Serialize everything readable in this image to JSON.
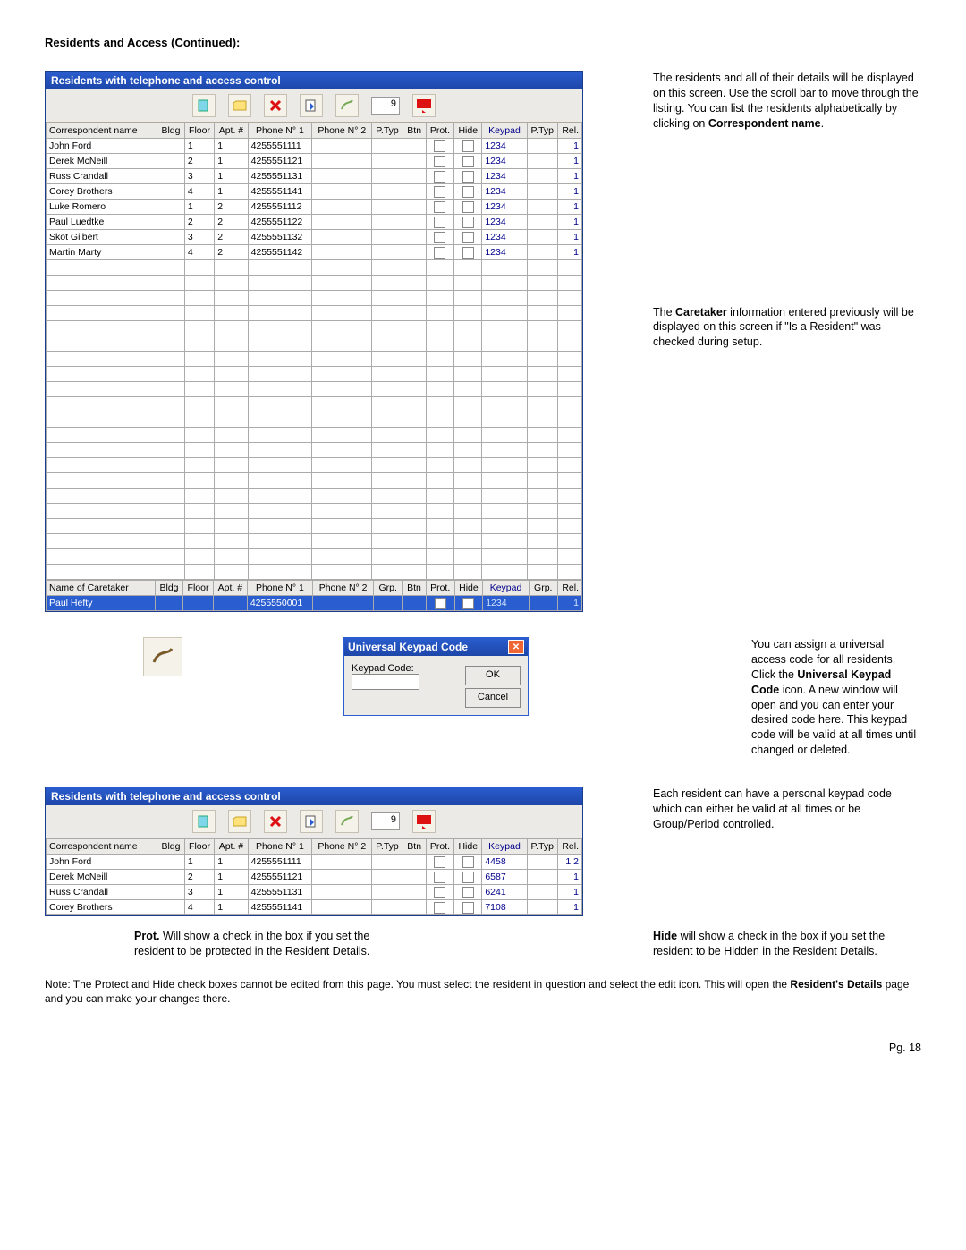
{
  "page_title": "Residents and Access (Continued):",
  "window_title": "Residents with telephone and access control",
  "toolbar_count": "9",
  "columns": [
    "Correspondent name",
    "Bldg",
    "Floor",
    "Apt. #",
    "Phone N° 1",
    "Phone N° 2",
    "P.Typ",
    "Btn",
    "Prot.",
    "Hide",
    "Keypad",
    "P.Typ",
    "Rel."
  ],
  "caretaker_columns": [
    "Name of Caretaker",
    "Bldg",
    "Floor",
    "Apt. #",
    "Phone N° 1",
    "Phone N° 2",
    "Grp.",
    "Btn",
    "Prot.",
    "Hide",
    "Keypad",
    "Grp.",
    "Rel."
  ],
  "residents1": [
    {
      "name": "John Ford",
      "bldg": "",
      "floor": "1",
      "apt": "1",
      "phone1": "4255551111",
      "keypad": "1234",
      "rel": "1"
    },
    {
      "name": "Derek McNeill",
      "bldg": "",
      "floor": "2",
      "apt": "1",
      "phone1": "4255551121",
      "keypad": "1234",
      "rel": "1"
    },
    {
      "name": "Russ Crandall",
      "bldg": "",
      "floor": "3",
      "apt": "1",
      "phone1": "4255551131",
      "keypad": "1234",
      "rel": "1"
    },
    {
      "name": "Corey Brothers",
      "bldg": "",
      "floor": "4",
      "apt": "1",
      "phone1": "4255551141",
      "keypad": "1234",
      "rel": "1"
    },
    {
      "name": "Luke Romero",
      "bldg": "",
      "floor": "1",
      "apt": "2",
      "phone1": "4255551112",
      "keypad": "1234",
      "rel": "1"
    },
    {
      "name": "Paul Luedtke",
      "bldg": "",
      "floor": "2",
      "apt": "2",
      "phone1": "4255551122",
      "keypad": "1234",
      "rel": "1"
    },
    {
      "name": "Skot Gilbert",
      "bldg": "",
      "floor": "3",
      "apt": "2",
      "phone1": "4255551132",
      "keypad": "1234",
      "rel": "1"
    },
    {
      "name": "Martin Marty",
      "bldg": "",
      "floor": "4",
      "apt": "2",
      "phone1": "4255551142",
      "keypad": "1234",
      "rel": "1"
    }
  ],
  "empty_rows_1": 21,
  "caretaker": {
    "name": "Paul Hefty",
    "phone1": "4255550001",
    "prot": false,
    "hide": true,
    "keypad": "1234",
    "rel": "1"
  },
  "dialog": {
    "title": "Universal Keypad Code",
    "label": "Keypad Code:",
    "ok": "OK",
    "cancel": "Cancel"
  },
  "residents2": [
    {
      "name": "John Ford",
      "bldg": "",
      "floor": "1",
      "apt": "1",
      "phone1": "4255551111",
      "keypad": "4458",
      "rel": "1 2"
    },
    {
      "name": "Derek McNeill",
      "bldg": "",
      "floor": "2",
      "apt": "1",
      "phone1": "4255551121",
      "keypad": "6587",
      "rel": "1"
    },
    {
      "name": "Russ Crandall",
      "bldg": "",
      "floor": "3",
      "apt": "1",
      "phone1": "4255551131",
      "keypad": "6241",
      "rel": "1"
    },
    {
      "name": "Corey Brothers",
      "bldg": "",
      "floor": "4",
      "apt": "1",
      "phone1": "4255551141",
      "keypad": "7108",
      "rel": "1"
    }
  ],
  "annot": {
    "a1_pre": "The residents and all of their details will be displayed on this screen.  Use the scroll bar to move through the listing.  You can list the residents alphabetically by clicking on ",
    "a1_bold": "Correspondent name",
    "a1_post": ".",
    "a2_pre": "The ",
    "a2_bold": "Caretaker",
    "a2_post": " information entered previously will be displayed on this screen if \"Is a Resident\" was checked during setup.",
    "a3_pre": "You can assign a universal access code for all residents. Click the ",
    "a3_bold": "Universal Keypad Code",
    "a3_post": " icon.  A new window will open and you can enter your desired code here.  This keypad code will be valid at all times until changed or deleted.",
    "a4": "Each resident can have a personal keypad code which can either be valid at all times or be Group/Period controlled.",
    "prot_bold": "Prot.",
    "prot_text": " Will show a check in the box if you set the resident to be protected in the Resident Details.",
    "hide_bold": "Hide",
    "hide_text": " will show a check in the box if you set the resident to be Hidden in the Resident Details."
  },
  "note_pre": "Note:  The Protect and Hide check boxes cannot be edited from this page.  You must select the resident in question and select the edit icon.  This will open the ",
  "note_bold": "Resident's Details",
  "note_post": " page and you can make your changes there.",
  "page_number": "Pg. 18"
}
